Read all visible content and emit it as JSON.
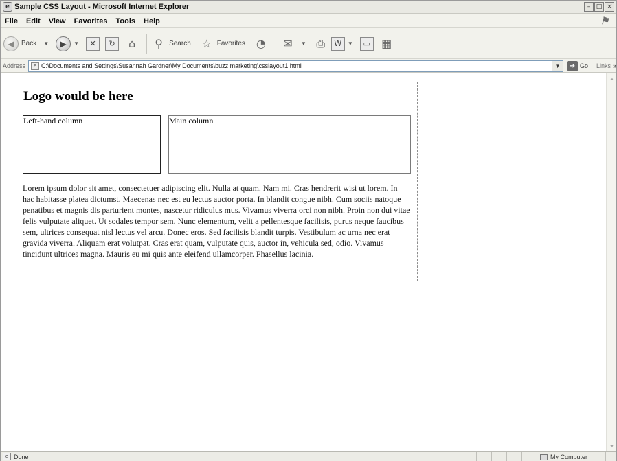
{
  "window": {
    "title": "Sample CSS Layout - Microsoft Internet Explorer",
    "controls": {
      "minimize": "–",
      "maximize": "□",
      "close": "×"
    }
  },
  "menubar": {
    "items": [
      "File",
      "Edit",
      "View",
      "Favorites",
      "Tools",
      "Help"
    ]
  },
  "toolbar": {
    "back_label": "Back",
    "search_label": "Search",
    "favorites_label": "Favorites"
  },
  "address": {
    "label": "Address",
    "value": "C:\\Documents and Settings\\Susannah Gardner\\My Documents\\buzz marketing\\csslayout1.html",
    "go_label": "Go",
    "links_label": "Links"
  },
  "page": {
    "logo_text": "Logo would be here",
    "left_column": "Left-hand column",
    "main_column": "Main column",
    "paragraph": "Lorem ipsum dolor sit amet, consectetuer adipiscing elit. Nulla at quam. Nam mi. Cras hendrerit wisi ut lorem. In hac habitasse platea dictumst. Maecenas nec est eu lectus auctor porta. In blandit congue nibh. Cum sociis natoque penatibus et magnis dis parturient montes, nascetur ridiculus mus. Vivamus viverra orci non nibh. Proin non dui vitae felis vulputate aliquet. Ut sodales tempor sem. Nunc elementum, velit a pellentesque facilisis, purus neque faucibus sem, ultrices consequat nisl lectus vel arcu. Donec eros. Sed facilisis blandit turpis. Vestibulum ac urna nec erat gravida viverra. Aliquam erat volutpat. Cras erat quam, vulputate quis, auctor in, vehicula sed, odio. Vivamus tincidunt ultrices magna. Mauris eu mi quis ante eleifend ullamcorper. Phasellus lacinia."
  },
  "status": {
    "text": "Done",
    "zone": "My Computer"
  }
}
